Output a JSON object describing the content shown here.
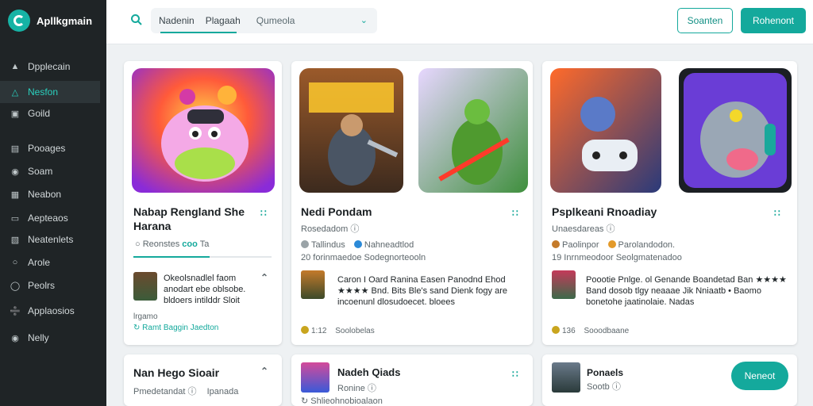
{
  "app": {
    "name": "Apllkgmain"
  },
  "sidebar": {
    "items": [
      {
        "label": "Dpplecain",
        "icon": "home-icon"
      },
      {
        "label": "Nesfon",
        "icon": "compass-icon",
        "active": true
      },
      {
        "label": "Goild",
        "icon": "image-icon"
      },
      {
        "label": "Pooages",
        "icon": "list-icon"
      },
      {
        "label": "Soam",
        "icon": "user-icon"
      },
      {
        "label": "Neabon",
        "icon": "grid-icon"
      },
      {
        "label": "Aepteaos",
        "icon": "chart-icon"
      },
      {
        "label": "Neatenlets",
        "icon": "library-icon"
      },
      {
        "label": "Arole",
        "icon": "profile-icon"
      },
      {
        "label": "Peolrs",
        "icon": "chat-icon"
      },
      {
        "label": "Applaosios",
        "icon": "wrench-icon"
      },
      {
        "label": "Nelly",
        "icon": "info-icon"
      }
    ]
  },
  "topbar": {
    "tab1": "Nadenin",
    "tab2": "Plagaah",
    "select": "Qumeola",
    "btn_outline": "Soanten",
    "btn_solid": "Rohenont"
  },
  "cards": {
    "c1": {
      "title": "Nabap Rengland She Harana",
      "meta1": "Reonstes",
      "meta2": "coo",
      "meta3": "Ta",
      "review": "Okeolsnadlel faom anodart ebe oblsobe. bldoers intilddr Sloit",
      "sub": "lrgamo",
      "foot": "Ramt Baggin Jaedton"
    },
    "c2": {
      "title": "Nedi Pondam",
      "meta1": "Rosedadom",
      "meta2": "Tallindus",
      "meta3": "Nahneadtlod",
      "meta4": "20 forinmaedoe Sodegnorteooln",
      "review": "Caron I Oard Ranina Easen Panodnd Ehod ★★★★ Bnd. Bits Ble's sand Dienk fogy are incoenunl dlosudoecet. bloees",
      "foot_num": "1:12",
      "foot": "Soolobelas"
    },
    "c3": {
      "title": "Psplkeani Rnoadiay",
      "meta1": "Unaesdareas",
      "meta2": "Paolinpor",
      "meta3": "Parolandodon.",
      "meta4": "19 Inrnmeodoor Seolgmatenadoo",
      "review": "Poootie Pnlge. ol Genande Boandetad Ban ★★★★ Band dosob tlgy neaaae Jik Nniaatb • Baomo bonetohe jaatinolaie. Nadas",
      "foot_num": "136",
      "foot": "Sooodbaane"
    },
    "c4": {
      "title": "Nan Hego Sioair",
      "meta1": "Pmedetandat",
      "meta2": "Ipanada"
    },
    "c5": {
      "title": "Nadeh Qiads",
      "meta1": "Ronine",
      "meta2": "Shlieohnobioalaon"
    },
    "c6": {
      "title": "Ponaels",
      "meta1": "Sootb",
      "button": "Neneot"
    }
  },
  "colors": {
    "accent": "#14a99c",
    "sidebar": "#1f2426",
    "active": "#2ad1bf",
    "star": "#f2b71e"
  }
}
